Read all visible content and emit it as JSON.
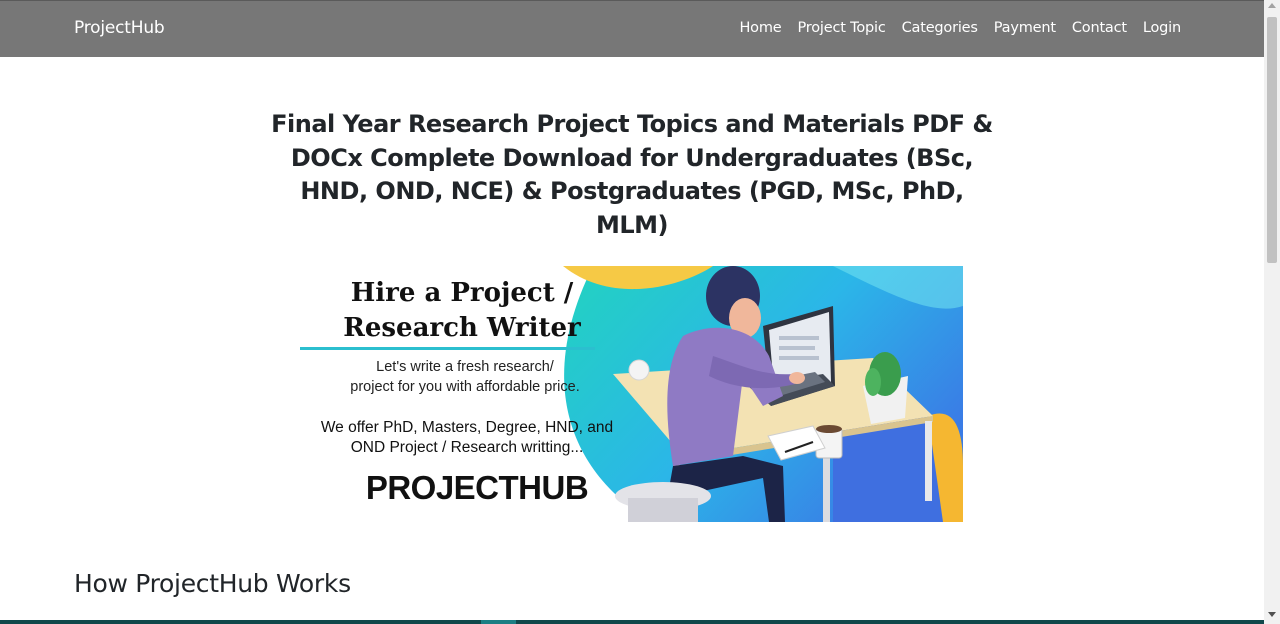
{
  "navbar": {
    "brand": "ProjectHub",
    "links": [
      "Home",
      "Project Topic",
      "Categories",
      "Payment",
      "Contact",
      "Login"
    ],
    "background": "#777777"
  },
  "hero": {
    "headline_lines": [
      "Final Year Research Project Topics and Materials PDF &",
      "DOCx Complete Download for Undergraduates (BSc,",
      "HND, OND, NCE) & Postgraduates (PGD, MSc, PhD, MLM)"
    ]
  },
  "banner": {
    "title_lines": [
      "Hire a Project /",
      "Research Writer"
    ],
    "sub_lines": [
      "Let's write a fresh research/",
      "project for you with affordable price."
    ],
    "offer_lines": [
      "We offer PhD, Masters, Degree, HND, and",
      "OND Project / Research writting..."
    ],
    "logo": "PROJECTHUB",
    "accent": "#2bbfcf"
  },
  "section": {
    "title": "How ProjectHub Works"
  }
}
